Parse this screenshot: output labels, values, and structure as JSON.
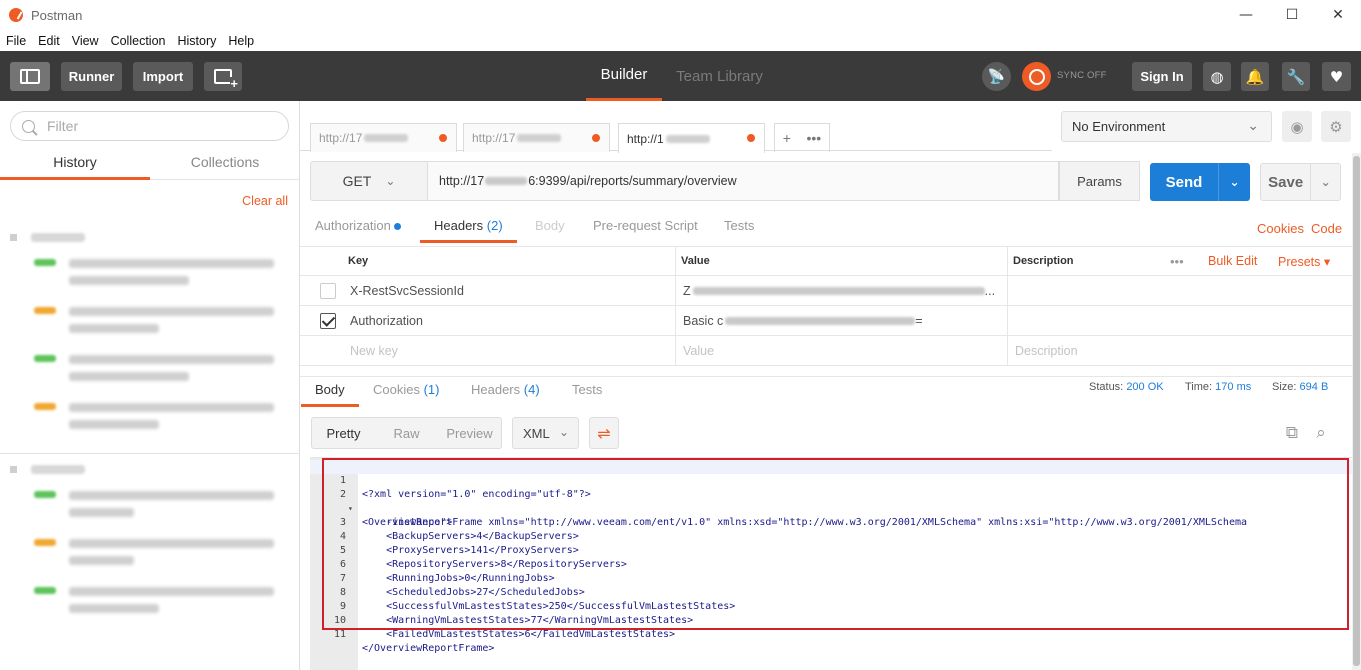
{
  "window": {
    "title": "Postman",
    "controls": {
      "minimize": "—",
      "maximize": "☐",
      "close": "✕"
    }
  },
  "menu": [
    "File",
    "Edit",
    "View",
    "Collection",
    "History",
    "Help"
  ],
  "toolbar": {
    "runner": "Runner",
    "import": "Import",
    "tabs": {
      "builder": "Builder",
      "team_library": "Team Library"
    },
    "sync_status": "SYNC OFF",
    "sign_in": "Sign In",
    "icons": [
      "satellite-icon",
      "sync-icon",
      "globe-icon",
      "bell-icon",
      "wrench-icon",
      "heart-icon"
    ],
    "accent": "#ef5b25"
  },
  "sidebar": {
    "filter_placeholder": "Filter",
    "tabs": {
      "history": "History",
      "collections": "Collections"
    },
    "clear_all": "Clear all"
  },
  "request_tabs": [
    {
      "prefix": "http://17"
    },
    {
      "prefix": "http://17"
    },
    {
      "prefix": "http://1",
      "active": true
    }
  ],
  "tab_more": "•••",
  "environment": {
    "selected": "No Environment"
  },
  "request": {
    "method": "GET",
    "url_prefix": "http://17",
    "url_suffix": "6:9399/api/reports/summary/overview",
    "params_label": "Params",
    "send_label": "Send",
    "save_label": "Save"
  },
  "request_subtabs": {
    "authorization": "Authorization",
    "headers": "Headers",
    "headers_count": "(2)",
    "body": "Body",
    "prerequest": "Pre-request Script",
    "tests": "Tests",
    "cookies": "Cookies",
    "code": "Code"
  },
  "headers_table": {
    "columns": {
      "key": "Key",
      "value": "Value",
      "description": "Description"
    },
    "more": "•••",
    "bulk_edit": "Bulk Edit",
    "presets": "Presets ▾",
    "rows": [
      {
        "key": "X-RestSvcSessionId",
        "value_prefix": "Z",
        "value_suffix": "...",
        "checked": false
      },
      {
        "key": "Authorization",
        "value_prefix": "Basic c",
        "value_suffix": "=",
        "checked": true
      }
    ],
    "new_row": {
      "key": "New key",
      "value": "Value",
      "description": "Description"
    }
  },
  "response": {
    "tabs": {
      "body": "Body",
      "cookies": "Cookies",
      "cookies_count": "(1)",
      "headers": "Headers",
      "headers_count": "(4)",
      "tests": "Tests"
    },
    "status_label": "Status:",
    "status": "200 OK",
    "time_label": "Time:",
    "time": "170 ms",
    "size_label": "Size:",
    "size": "694 B",
    "formats": {
      "pretty": "Pretty",
      "raw": "Raw",
      "preview": "Preview"
    },
    "language": "XML",
    "code_lines": [
      {
        "n": "1",
        "text": "<?xml version=\"1.0\" encoding=\"utf-8\"?>"
      },
      {
        "n": "2",
        "text": "<OverviewReportFrame xmlns=\"http://www.veeam.com/ent/v1.0\" xmlns:xsd=\"http://www.w3.org/2001/XMLSchema\" xmlns:xsi=\"http://www.w3.org/2001/XMLSchema",
        "fold": "▾"
      },
      {
        "n": "",
        "text": "    -instance\">"
      },
      {
        "n": "3",
        "text": "    <BackupServers>4</BackupServers>"
      },
      {
        "n": "4",
        "text": "    <ProxyServers>141</ProxyServers>"
      },
      {
        "n": "5",
        "text": "    <RepositoryServers>8</RepositoryServers>"
      },
      {
        "n": "6",
        "text": "    <RunningJobs>0</RunningJobs>"
      },
      {
        "n": "7",
        "text": "    <ScheduledJobs>27</ScheduledJobs>"
      },
      {
        "n": "8",
        "text": "    <SuccessfulVmLastestStates>250</SuccessfulVmLastestStates>"
      },
      {
        "n": "9",
        "text": "    <WarningVmLastestStates>77</WarningVmLastestStates>"
      },
      {
        "n": "10",
        "text": "    <FailedVmLastestStates>6</FailedVmLastestStates>"
      },
      {
        "n": "11",
        "text": "</OverviewReportFrame>"
      }
    ]
  }
}
